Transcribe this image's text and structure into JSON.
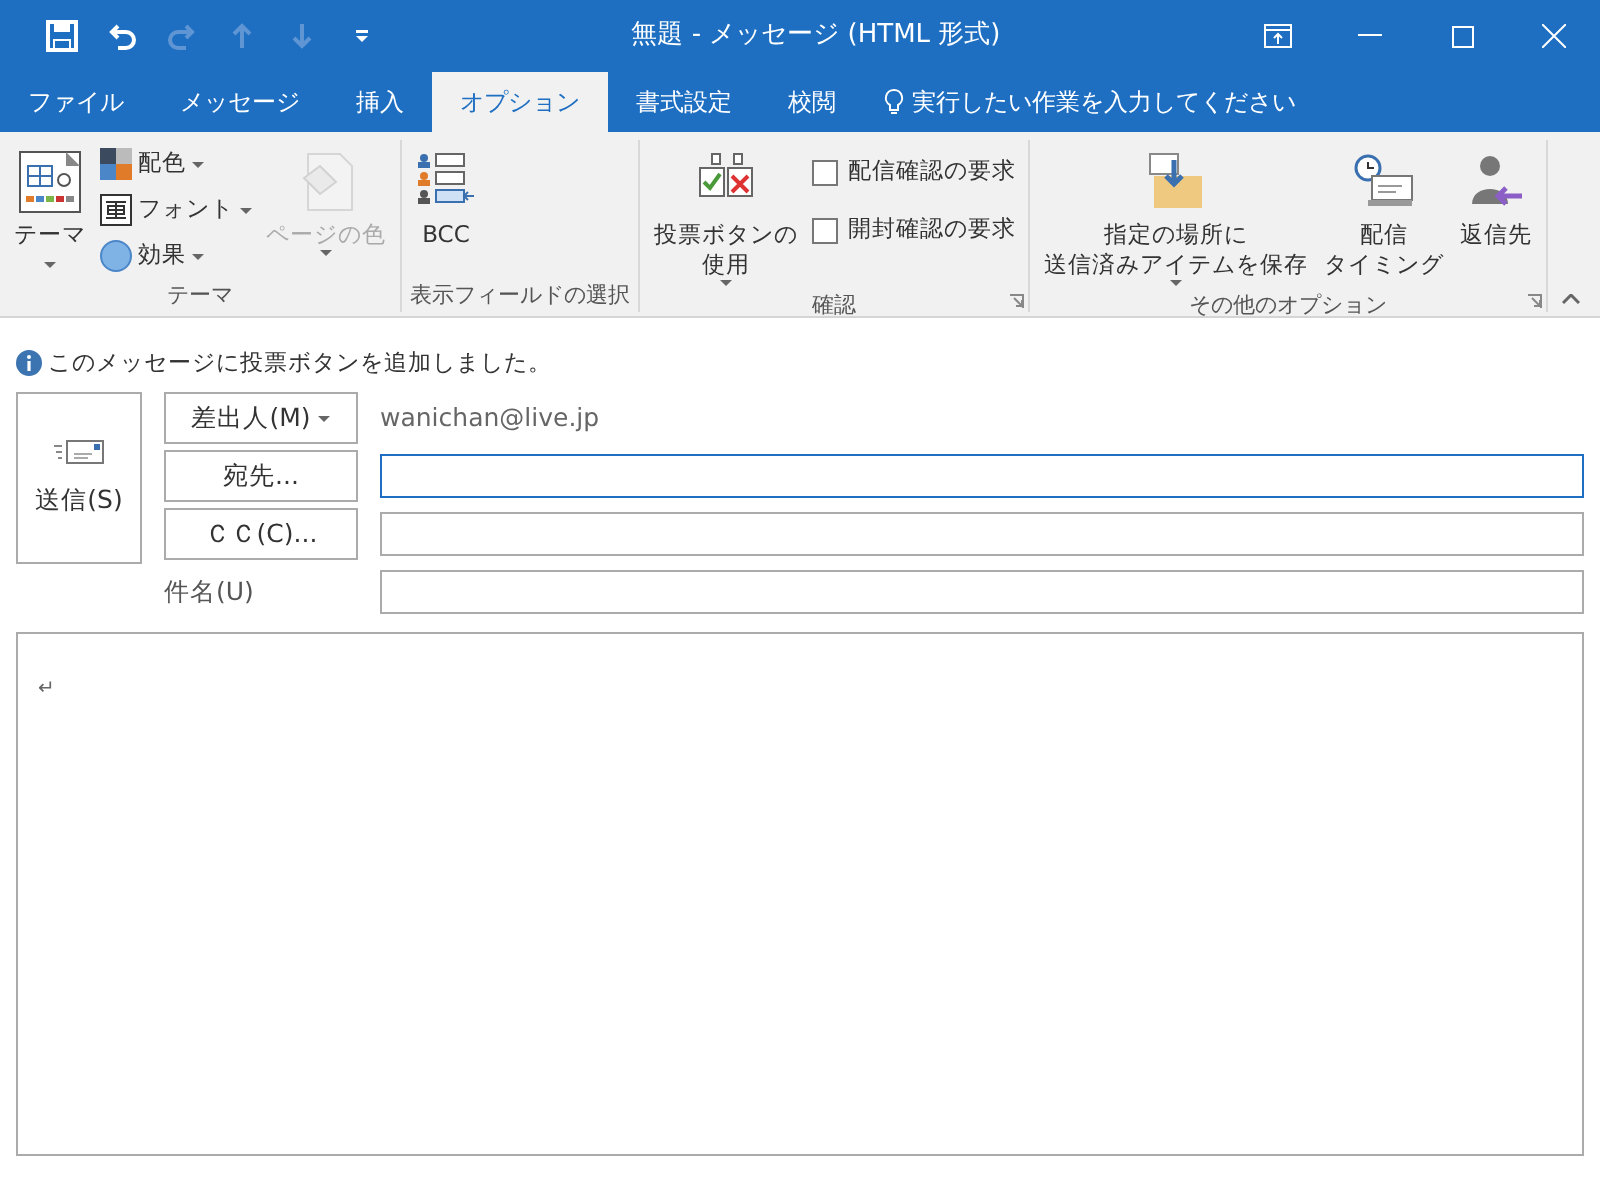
{
  "quick_access": [
    {
      "kind": "save",
      "disabled": false
    },
    {
      "kind": "undo",
      "disabled": false
    },
    {
      "kind": "redo",
      "disabled": true
    },
    {
      "kind": "up",
      "disabled": true
    },
    {
      "kind": "down",
      "disabled": true
    },
    {
      "kind": "customize",
      "disabled": false
    }
  ],
  "window": {
    "title": "無題 - メッセージ (HTML 形式)"
  },
  "tabs": [
    {
      "label": "ファイル",
      "selected": false
    },
    {
      "label": "メッセージ",
      "selected": false
    },
    {
      "label": "挿入",
      "selected": false
    },
    {
      "label": "オプション",
      "selected": true
    },
    {
      "label": "書式設定",
      "selected": false
    },
    {
      "label": "校閲",
      "selected": false
    }
  ],
  "tell_me": {
    "placeholder": "実行したい作業を入力してください"
  },
  "ribbon": {
    "groups": [
      {
        "label": "テーマ",
        "items": [
          {
            "kind": "large",
            "lines": [
              "テーマ"
            ],
            "dropdown": true
          },
          {
            "kind": "small",
            "label": "配色",
            "dropdown": true
          },
          {
            "kind": "small",
            "label": "フォント",
            "dropdown": true
          },
          {
            "kind": "small",
            "label": "効果",
            "dropdown": true
          },
          {
            "kind": "large",
            "lines": [
              "ページの色"
            ],
            "dropdown": true,
            "disabled": true
          }
        ]
      },
      {
        "label": "表示フィールドの選択",
        "items": [
          {
            "kind": "large",
            "lines": [
              "BCC"
            ]
          }
        ]
      },
      {
        "label": "確認",
        "launcher": true,
        "items": [
          {
            "kind": "large",
            "lines": [
              "投票ボタンの",
              "使用"
            ],
            "dropdown": true
          },
          {
            "kind": "check",
            "label": "配信確認の要求",
            "checked": false
          },
          {
            "kind": "check",
            "label": "開封確認の要求",
            "checked": false
          }
        ]
      },
      {
        "label": "その他のオプション",
        "launcher": true,
        "items": [
          {
            "kind": "large",
            "lines": [
              "指定の場所に",
              "送信済みアイテムを保存"
            ],
            "dropdown": true
          },
          {
            "kind": "large",
            "lines": [
              "配信",
              "タイミング"
            ]
          },
          {
            "kind": "large",
            "lines": [
              "返信先"
            ]
          }
        ]
      }
    ]
  },
  "info_bar": {
    "text": "このメッセージに投票ボタンを追加しました。"
  },
  "compose": {
    "send": "送信(S)",
    "from": {
      "button": "差出人(M)",
      "value": "wanichan@live.jp"
    },
    "to": {
      "button": "宛先...",
      "focused": true
    },
    "cc": {
      "button": "ＣＣ(C)...",
      "focused": false
    },
    "subject": {
      "label": "件名(U)",
      "focused": false
    },
    "body": {
      "text": "↵"
    }
  }
}
